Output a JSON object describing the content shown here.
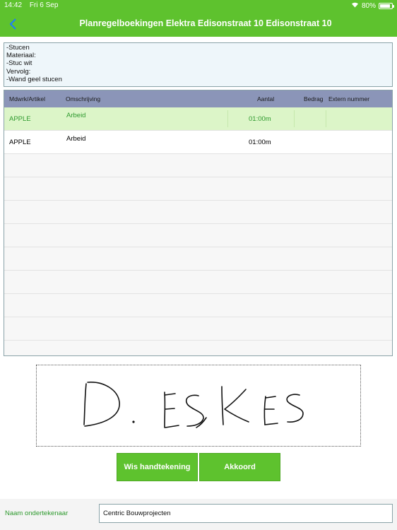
{
  "status": {
    "time": "14:42",
    "date": "Fri 6 Sep",
    "battery_text": "80%",
    "battery_level": 0.8
  },
  "nav": {
    "title": "Planregelboekingen Elektra Edisonstraat 10 Edisonstraat 10",
    "back_icon": "chevron-left-icon"
  },
  "notes": [
    "-Stucen",
    "Materiaal:",
    "-Stuc wit",
    "Vervolg:",
    "-Wand geel stucen"
  ],
  "table": {
    "headers": {
      "article": "Mdwrk/Artikel",
      "description": "Omschrijving",
      "amount": "Aantal",
      "price": "Bedrag",
      "external": "Extern nummer"
    },
    "rows": [
      {
        "article": "APPLE",
        "description": "Arbeid",
        "amount": "01:00m",
        "selected": true
      },
      {
        "article": "APPLE",
        "description": "Arbeid",
        "amount": "01:00m",
        "selected": false
      }
    ],
    "empty_rows": 9
  },
  "signature": {
    "drawn_text": "D. ESKES"
  },
  "buttons": {
    "clear": "Wis handtekening",
    "accept": "Akkoord"
  },
  "signer": {
    "label": "Naam ondertekenaar",
    "value": "Centric Bouwprojecten"
  },
  "colors": {
    "accent": "#5ec22e",
    "header": "#8b95b8",
    "selected_row": "#dcf5c8",
    "link": "#1d7bff"
  }
}
